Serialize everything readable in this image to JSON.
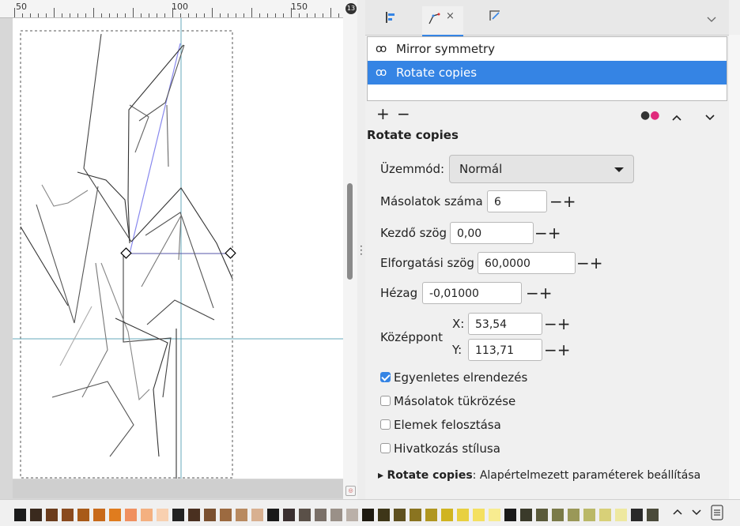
{
  "ruler": {
    "labels": [
      "50",
      "100",
      "150"
    ],
    "badge": "13"
  },
  "tabs": [
    {
      "name": "align-tab",
      "icon": "align-icon"
    },
    {
      "name": "path-effects-tab",
      "icon": "path-effect-icon",
      "close": "×"
    },
    {
      "name": "edit-tab",
      "icon": "edit-icon"
    }
  ],
  "effects": {
    "items": [
      {
        "label": "Mirror symmetry",
        "eye": "ꝏ"
      },
      {
        "label": "Rotate copies",
        "eye": "ꝏ"
      }
    ]
  },
  "toolbar": {
    "add": "+",
    "remove": "−",
    "up": "⌃",
    "down": "⌄"
  },
  "section_title": "Rotate copies",
  "params": {
    "mode_label": "Üzemmód:",
    "mode_value": "Normál",
    "copies_label": "Másolatok száma",
    "copies_value": "6",
    "start_angle_label": "Kezdő szög",
    "start_angle_value": "0,00",
    "rotation_angle_label": "Elforgatási szög",
    "rotation_angle_value": "60,0000",
    "gap_label": "Hézag",
    "gap_value": "-0,01000",
    "center_label": "Középpont",
    "x_label": "X:",
    "x_value": "53,54",
    "y_label": "Y:",
    "y_value": "113,71",
    "pm": "−+"
  },
  "checkboxes": [
    {
      "label": "Egyenletes elrendezés",
      "checked": true
    },
    {
      "label": "Másolatok tükrözése",
      "checked": false
    },
    {
      "label": "Elemek felosztása",
      "checked": false
    },
    {
      "label": "Hivatkozás stílusa",
      "checked": false
    }
  ],
  "defaults": {
    "arrow": "▸",
    "bold": "Rotate copies",
    "rest": ": Alapértelmezett paraméterek beállítása"
  },
  "palette": {
    "colors": [
      "#1a1a1a",
      "#3a2a1e",
      "#6b3c1c",
      "#8a4a1e",
      "#a85a18",
      "#c86a1a",
      "#e07c1e",
      "#f09060",
      "#f4b080",
      "#f8d0b0",
      "#222222",
      "#4a3020",
      "#7a5030",
      "#9c6a40",
      "#b88a60",
      "#d8b090",
      "#1a1a1a",
      "#3a3030",
      "#5a5048",
      "#7a7068",
      "#9a9088",
      "#bab0a8",
      "#1e1a10",
      "#3e3618",
      "#5e5020",
      "#8a7420",
      "#b09620",
      "#d0b420",
      "#e8d040",
      "#f4e060",
      "#f8ec90",
      "#1a1a1a",
      "#3a3a2a",
      "#5a5a3a",
      "#7a7a48",
      "#9a9858",
      "#bab868",
      "#d8d078",
      "#eee8a0",
      "#2a2a2a",
      "#4a4a3a"
    ],
    "buttons": "⌃ ⌄ ☰"
  }
}
